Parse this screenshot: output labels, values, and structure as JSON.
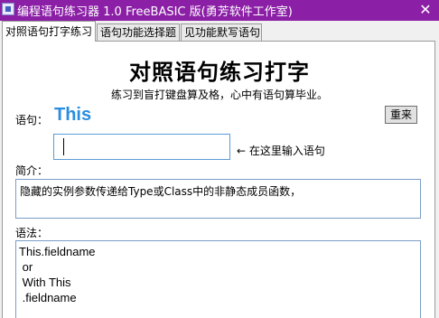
{
  "window": {
    "title": "编程语句练习器 1.0 FreeBASIC 版(勇芳软件工作室)",
    "close": "✕"
  },
  "tabs": [
    {
      "label": "对照语句打字练习"
    },
    {
      "label": "语句功能选择题"
    },
    {
      "label": "见功能默写语句"
    }
  ],
  "main": {
    "title": "对照语句练习打字",
    "subtitle": "练习到盲打键盘算及格，心中有语句算毕业。",
    "statement_label": "语句：",
    "statement_word": "This",
    "reset_button": "重来",
    "input_value": "",
    "input_hint": "← 在这里输入语句",
    "intro_label": "简介：",
    "intro_text": "隐藏的实例参数传递给Type或Class中的非静态成员函数，",
    "syntax_label": "语法：",
    "syntax_lines": [
      "This.fieldname",
      " or",
      " With This",
      " .fieldname"
    ]
  }
}
